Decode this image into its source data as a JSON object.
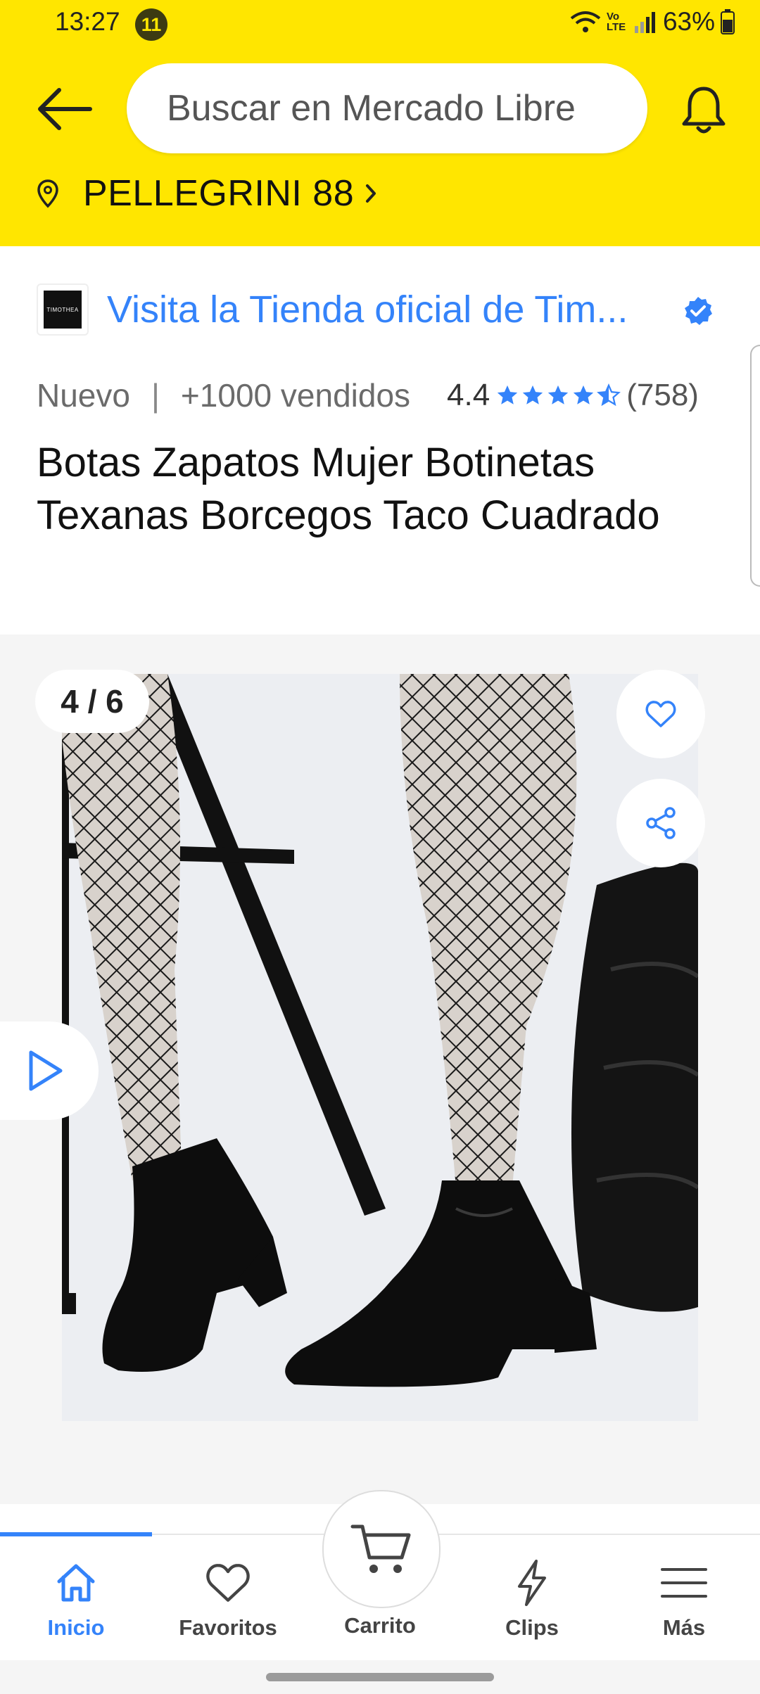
{
  "status_bar": {
    "time": "13:27",
    "notification_count": "11",
    "network": "Vo LTE",
    "battery": "63%"
  },
  "header": {
    "search_placeholder": "Buscar en Mercado Libre",
    "location": "PELLEGRINI 88",
    "background_color": "#FFE600"
  },
  "store": {
    "logo_text": "TIMOTHEA",
    "link_text": "Visita la Tienda oficial de Tim...",
    "link_color": "#3483FA"
  },
  "product": {
    "condition": "Nuevo",
    "separator": "|",
    "sold": "+1000 vendidos",
    "rating": "4.4",
    "stars": 4.5,
    "reviews": "(758)",
    "title": "Botas Zapatos Mujer Botinetas Texanas Borcegos Taco Cuadrado"
  },
  "gallery": {
    "counter": "4 / 6",
    "current": 4,
    "total": 6
  },
  "bottom_nav": {
    "items": [
      {
        "label": "Inicio",
        "icon": "home-icon",
        "active": true
      },
      {
        "label": "Favoritos",
        "icon": "heart-icon",
        "active": false
      },
      {
        "label": "Carrito",
        "icon": "cart-icon",
        "active": false
      },
      {
        "label": "Clips",
        "icon": "lightning-icon",
        "active": false
      },
      {
        "label": "Más",
        "icon": "menu-icon",
        "active": false
      }
    ]
  }
}
